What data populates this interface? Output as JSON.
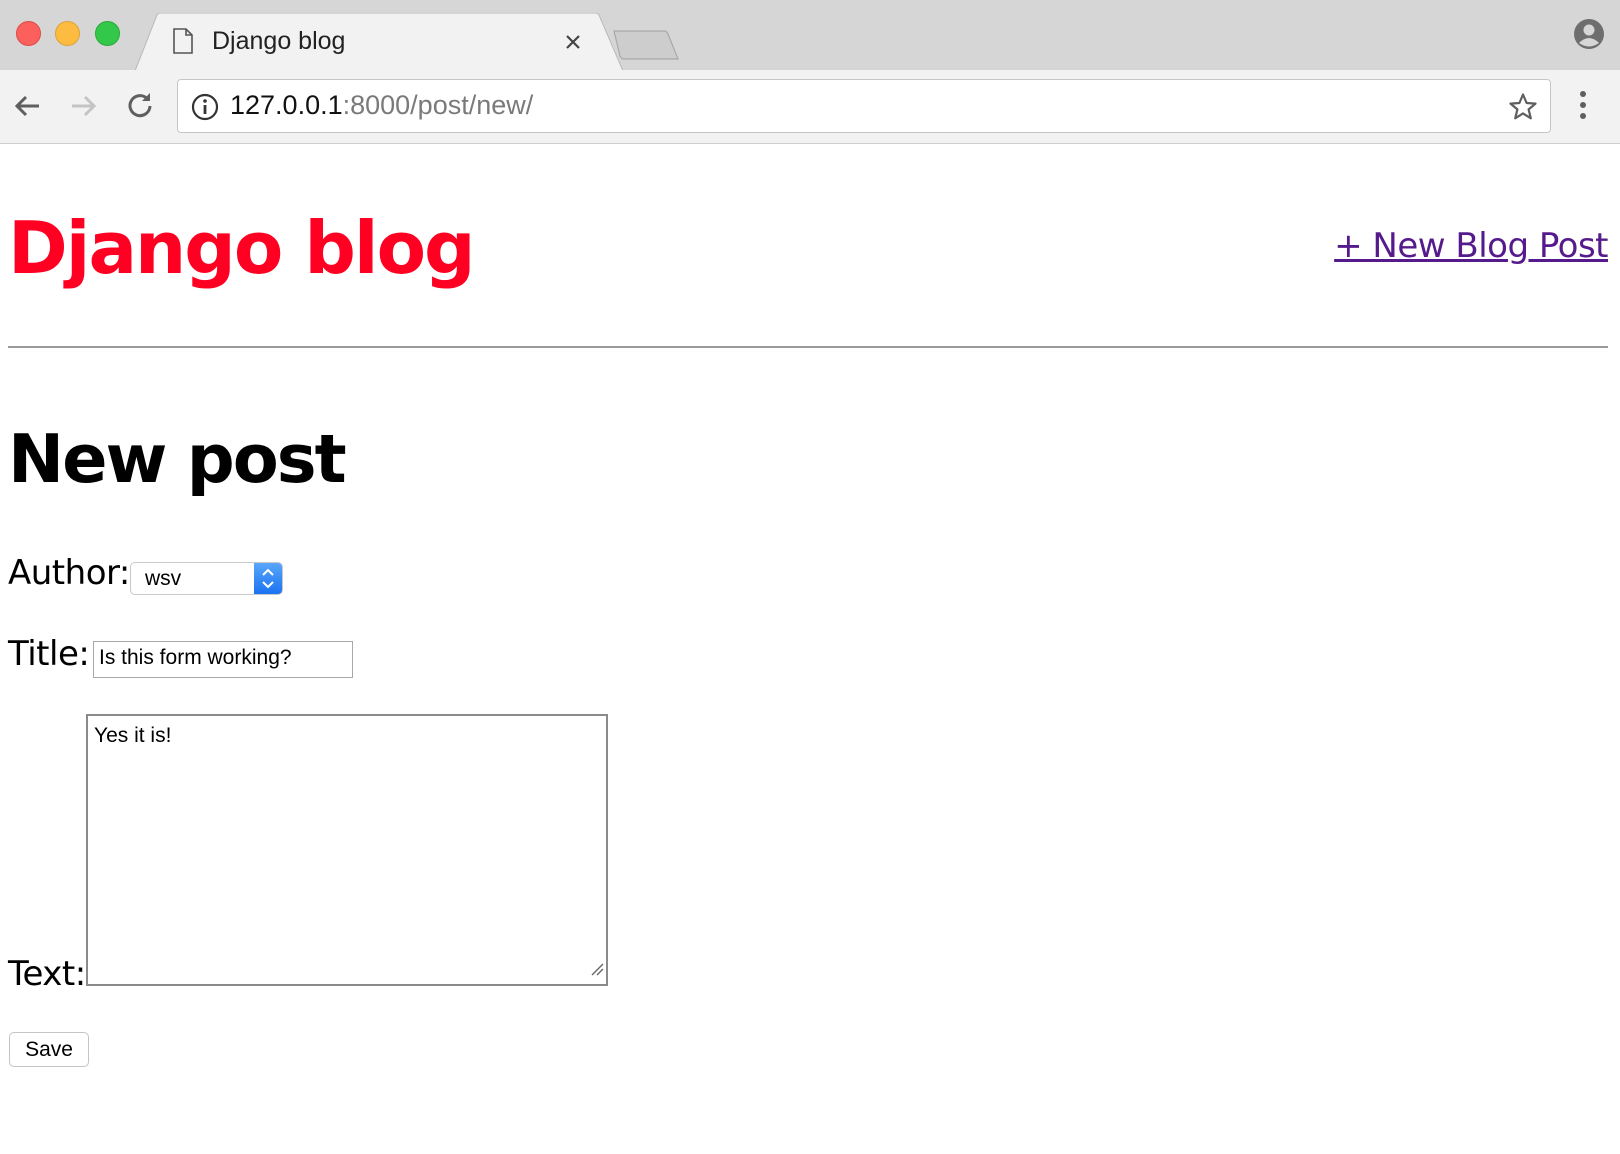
{
  "browser": {
    "tab_title": "Django blog",
    "url_host": "127.0.0.1",
    "url_rest": ":8000/post/new/"
  },
  "site": {
    "title": "Django blog",
    "new_post_link": "+ New Blog Post",
    "title_color": "#ff0022",
    "link_color": "#551a8b"
  },
  "form": {
    "heading": "New post",
    "author_label": "Author:",
    "author_value": "wsv",
    "title_label": "Title:",
    "title_value": "Is this form working?",
    "text_label": "Text:",
    "text_value": "Yes it is!",
    "save_label": "Save"
  },
  "icons": {
    "back": "arrow-left-icon",
    "forward": "arrow-right-icon",
    "reload": "reload-icon",
    "info": "info-icon",
    "star": "star-icon",
    "menu": "vertical-dots-icon",
    "profile": "profile-icon"
  }
}
